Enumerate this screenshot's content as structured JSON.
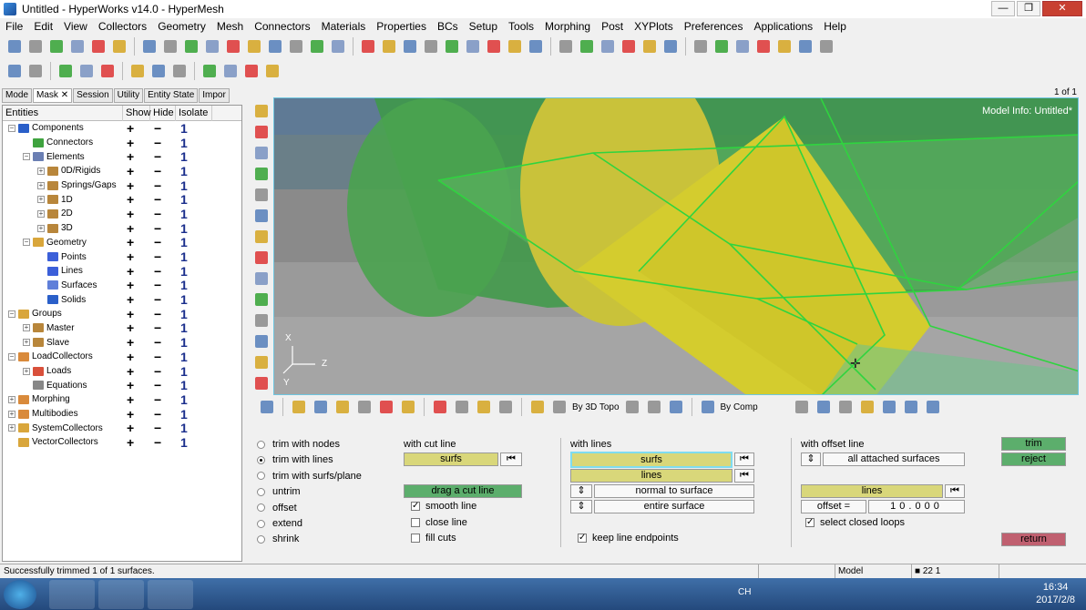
{
  "window": {
    "title": "Untitled - HyperWorks v14.0 - HyperMesh",
    "min": "—",
    "max": "❐",
    "close": "✕"
  },
  "menu": [
    "File",
    "Edit",
    "View",
    "Collectors",
    "Geometry",
    "Mesh",
    "Connectors",
    "Materials",
    "Properties",
    "BCs",
    "Setup",
    "Tools",
    "Morphing",
    "Post",
    "XYPlots",
    "Preferences",
    "Applications",
    "Help"
  ],
  "tabs": [
    "Mode",
    "Mask",
    "Session",
    "Utility",
    "Entity State",
    "Impor"
  ],
  "tree": {
    "headers": [
      "Entities",
      "Show",
      "Hide",
      "Isolate"
    ],
    "rows": [
      {
        "label": "Components",
        "indent": 0,
        "exp": "−",
        "color": "#2a5fc9"
      },
      {
        "label": "Connectors",
        "indent": 1,
        "exp": "",
        "color": "#3fa33f"
      },
      {
        "label": "Elements",
        "indent": 1,
        "exp": "−",
        "color": "#6b7fb3"
      },
      {
        "label": "0D/Rigids",
        "indent": 2,
        "exp": "+",
        "color": "#b8863b"
      },
      {
        "label": "Springs/Gaps",
        "indent": 2,
        "exp": "+",
        "color": "#b8863b"
      },
      {
        "label": "1D",
        "indent": 2,
        "exp": "+",
        "color": "#b8863b"
      },
      {
        "label": "2D",
        "indent": 2,
        "exp": "+",
        "color": "#b8863b"
      },
      {
        "label": "3D",
        "indent": 2,
        "exp": "+",
        "color": "#b8863b"
      },
      {
        "label": "Geometry",
        "indent": 1,
        "exp": "−",
        "color": "#d9a63b"
      },
      {
        "label": "Points",
        "indent": 2,
        "exp": "",
        "color": "#3b5fd9"
      },
      {
        "label": "Lines",
        "indent": 2,
        "exp": "",
        "color": "#3b5fd9"
      },
      {
        "label": "Surfaces",
        "indent": 2,
        "exp": "",
        "color": "#5f7fd9"
      },
      {
        "label": "Solids",
        "indent": 2,
        "exp": "",
        "color": "#2a5fc9"
      },
      {
        "label": "Groups",
        "indent": 0,
        "exp": "−",
        "color": "#d9a63b"
      },
      {
        "label": "Master",
        "indent": 1,
        "exp": "+",
        "color": "#b8863b"
      },
      {
        "label": "Slave",
        "indent": 1,
        "exp": "+",
        "color": "#b8863b"
      },
      {
        "label": "LoadCollectors",
        "indent": 0,
        "exp": "−",
        "color": "#d98a3b"
      },
      {
        "label": "Loads",
        "indent": 1,
        "exp": "+",
        "color": "#d9503b"
      },
      {
        "label": "Equations",
        "indent": 1,
        "exp": "",
        "color": "#888"
      },
      {
        "label": "Morphing",
        "indent": 0,
        "exp": "+",
        "color": "#d98a3b"
      },
      {
        "label": "Multibodies",
        "indent": 0,
        "exp": "+",
        "color": "#d98a3b"
      },
      {
        "label": "SystemCollectors",
        "indent": 0,
        "exp": "+",
        "color": "#d9a63b"
      },
      {
        "label": "VectorCollectors",
        "indent": 0,
        "exp": "",
        "color": "#d9a63b"
      }
    ],
    "show": "+",
    "hide": "−",
    "isolate": "1"
  },
  "viewport": {
    "page": "1 of 1",
    "model_info": "Model Info: Untitled*",
    "axis_x": "X",
    "axis_y": "Y",
    "axis_z": "Z"
  },
  "viewtb": {
    "by_topo": "By 3D Topo",
    "by_comp": "By Comp"
  },
  "panel": {
    "options": [
      "trim with nodes",
      "trim with lines",
      "trim with surfs/plane",
      "untrim",
      "offset",
      "extend",
      "shrink"
    ],
    "selected": 1,
    "cut": {
      "header": "with cut line",
      "surfs": "surfs",
      "drag": "drag a cut line",
      "smooth": "smooth line",
      "close": "close line",
      "fill": "fill cuts"
    },
    "lines": {
      "header": "with lines",
      "surfs": "surfs",
      "lines": "lines",
      "normal": "normal to surface",
      "entire": "entire surface",
      "keep": "keep line endpoints"
    },
    "offset": {
      "header": "with offset line",
      "attached": "all attached surfaces",
      "lines": "lines",
      "offset_label": "offset =",
      "offset_value": "10.000",
      "select_closed": "select closed loops"
    },
    "trim": "trim",
    "reject": "reject",
    "return": "return"
  },
  "status": {
    "message": "Successfully trimmed 1 of 1 surfaces.",
    "model": "Model",
    "comp": "22 1"
  },
  "taskbar": {
    "time": "16:34",
    "date": "2017/2/8",
    "lang": "CH"
  }
}
